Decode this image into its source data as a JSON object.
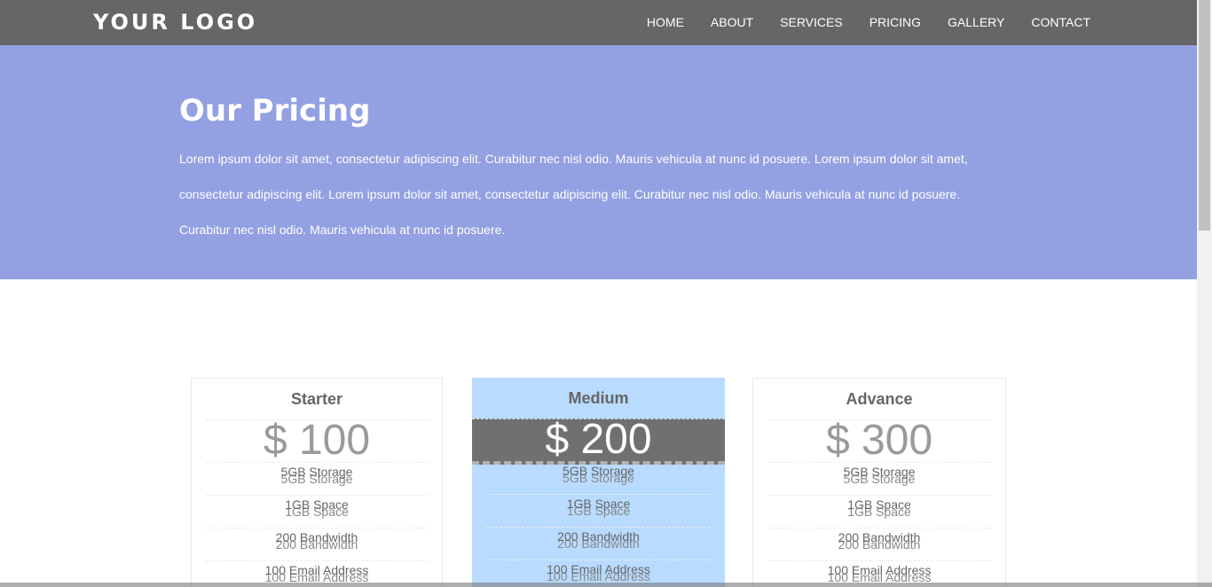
{
  "header": {
    "logo": "YOUR LOGO",
    "nav": [
      "HOME",
      "ABOUT",
      "SERVICES",
      "PRICING",
      "GALLERY",
      "CONTACT"
    ]
  },
  "hero": {
    "title": "Our Pricing",
    "text": "Lorem ipsum dolor sit amet, consectetur adipiscing elit. Curabitur nec nisl odio. Mauris vehicula at nunc id posuere. Lorem ipsum dolor sit amet, consectetur adipiscing elit. Lorem ipsum dolor sit amet, consectetur adipiscing elit. Curabitur nec nisl odio. Mauris vehicula at nunc id posuere. Curabitur nec nisl odio. Mauris vehicula at nunc id posuere."
  },
  "plans": [
    {
      "name": "Starter",
      "price": "$ 100",
      "features": [
        "5GB Storage",
        "1GB Space",
        "200 Bandwidth",
        "100 Email Address"
      ]
    },
    {
      "name": "Medium",
      "price": "$ 200",
      "features": [
        "5GB Storage",
        "1GB Space",
        "200 Bandwidth",
        "100 Email Address"
      ]
    },
    {
      "name": "Advance",
      "price": "$ 300",
      "features": [
        "5GB Storage",
        "1GB Space",
        "200 Bandwidth",
        "100 Email Address"
      ]
    }
  ],
  "colors": {
    "header_bg": "#666666",
    "hero_bg": "#93a0e2",
    "featured_bg": "#b8dbff",
    "featured_price_bg": "#707070"
  }
}
